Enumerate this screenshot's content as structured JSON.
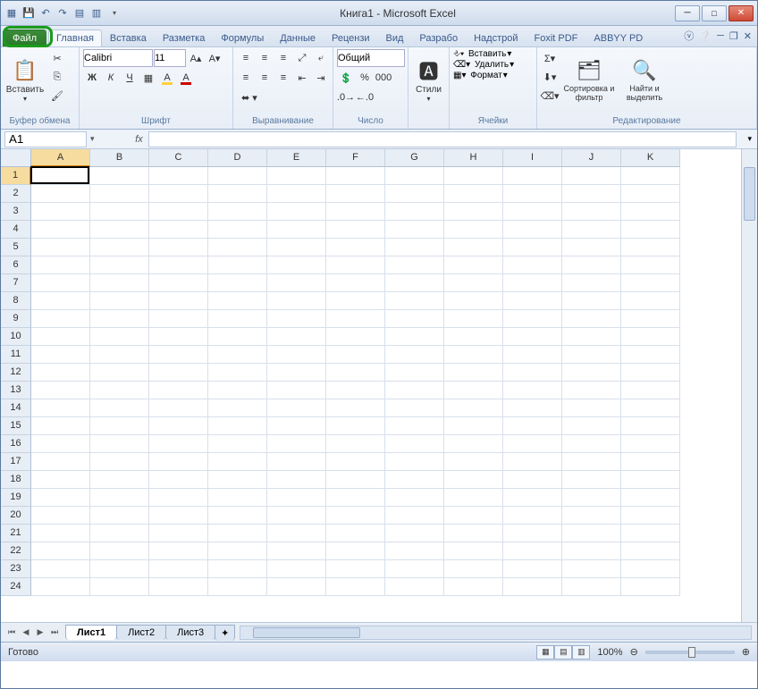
{
  "title": "Книга1  -  Microsoft Excel",
  "tabs": {
    "file": "Файл",
    "home": "Главная",
    "insert": "Вставка",
    "layout": "Разметка",
    "formulas": "Формулы",
    "data": "Данные",
    "review": "Рецензи",
    "view": "Вид",
    "developer": "Разрабо",
    "addins": "Надстрой",
    "foxit": "Foxit PDF",
    "abbyy": "ABBYY PD"
  },
  "ribbon": {
    "clipboard": {
      "label": "Буфер обмена",
      "paste": "Вставить"
    },
    "font": {
      "label": "Шрифт",
      "name": "Calibri",
      "size": "11",
      "bold": "Ж",
      "italic": "К",
      "underline": "Ч"
    },
    "alignment": {
      "label": "Выравнивание"
    },
    "number": {
      "label": "Число",
      "format": "Общий"
    },
    "styles": {
      "label": "",
      "styles_btn": "Стили"
    },
    "cells": {
      "label": "Ячейки",
      "insert": "Вставить",
      "delete": "Удалить",
      "format": "Формат"
    },
    "editing": {
      "label": "Редактирование",
      "sort": "Сортировка и фильтр",
      "find": "Найти и выделить"
    }
  },
  "formula_bar": {
    "name_box": "A1",
    "fx": "fx"
  },
  "columns": [
    "A",
    "B",
    "C",
    "D",
    "E",
    "F",
    "G",
    "H",
    "I",
    "J",
    "K"
  ],
  "rows": [
    "1",
    "2",
    "3",
    "4",
    "5",
    "6",
    "7",
    "8",
    "9",
    "10",
    "11",
    "12",
    "13",
    "14",
    "15",
    "16",
    "17",
    "18",
    "19",
    "20",
    "21",
    "22",
    "23",
    "24"
  ],
  "active_cell": {
    "col": 0,
    "row": 0
  },
  "sheets": {
    "s1": "Лист1",
    "s2": "Лист2",
    "s3": "Лист3"
  },
  "status": {
    "ready": "Готово",
    "zoom": "100%"
  }
}
